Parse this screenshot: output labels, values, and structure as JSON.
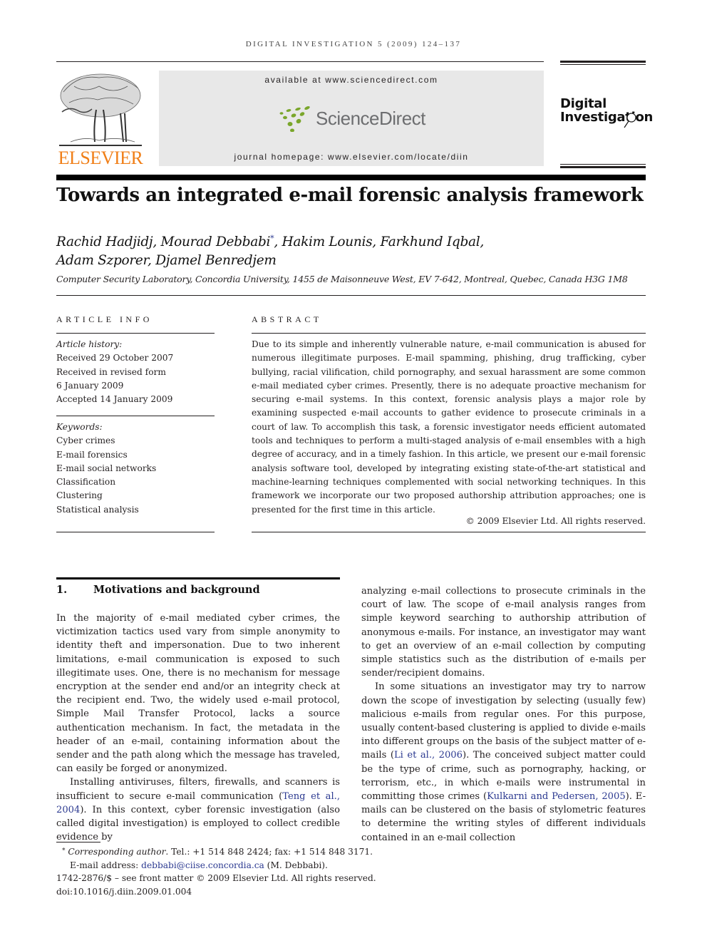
{
  "running_head": "DIGITAL INVESTIGATION 5 (2009) 124–137",
  "header": {
    "publisher_logo_text": "ELSEVIER",
    "available_at": "available at www.sciencedirect.com",
    "sciencedirect_logo_text": "ScienceDirect",
    "journal_homepage": "journal homepage: www.elsevier.com/locate/diin",
    "journal_logo_line1": "Digital",
    "journal_logo_line2": "Investigation",
    "colors": {
      "elsevier_orange": "#f07f18",
      "sciencedirect_green": "#7aa62b",
      "link_blue": "#2b3990"
    }
  },
  "article": {
    "title": "Towards an integrated e-mail forensic analysis framework",
    "authors_line1": "Rachid Hadjidj, Mourad Debbabi",
    "corresponding_mark": "*",
    "authors_line1_rest": ", Hakim Lounis, Farkhund Iqbal,",
    "authors_line2": "Adam Szporer, Djamel Benredjem",
    "affiliation": "Computer Security Laboratory, Concordia University, 1455 de Maisonneuve West, EV 7-642, Montreal, Quebec, Canada H3G 1M8"
  },
  "article_info": {
    "heading": "ARTICLE INFO",
    "history_label": "Article history:",
    "history": [
      "Received 29 October 2007",
      "Received in revised form",
      "6 January 2009",
      "Accepted 14 January 2009"
    ],
    "keywords_label": "Keywords:",
    "keywords": [
      "Cyber crimes",
      "E-mail forensics",
      "E-mail social networks",
      "Classification",
      "Clustering",
      "Statistical analysis"
    ]
  },
  "abstract": {
    "heading": "ABSTRACT",
    "text": "Due to its simple and inherently vulnerable nature, e-mail communication is abused for numerous illegitimate purposes. E-mail spamming, phishing, drug trafficking, cyber bullying, racial vilification, child pornography, and sexual harassment are some common e-mail mediated cyber crimes. Presently, there is no adequate proactive mechanism for securing e-mail systems. In this context, forensic analysis plays a major role by examining suspected e-mail accounts to gather evidence to prosecute criminals in a court of law. To accomplish this task, a forensic investigator needs efficient automated tools and techniques to perform a multi-staged analysis of e-mail ensembles with a high degree of accuracy, and in a timely fashion. In this article, we present our e-mail forensic analysis software tool, developed by integrating existing state-of-the-art statistical and machine-learning techniques complemented with social networking techniques. In this framework we incorporate our two proposed authorship attribution approaches; one is presented for the first time in this article.",
    "copyright": "© 2009 Elsevier Ltd. All rights reserved."
  },
  "section1": {
    "number": "1.",
    "title": "Motivations and background",
    "left_p1": "In the majority of e-mail mediated cyber crimes, the victimization tactics used vary from simple anonymity to identity theft and impersonation. Due to two inherent limitations, e-mail communication is exposed to such illegitimate uses. One, there is no mechanism for message encryption at the sender end and/or an integrity check at the recipient end. Two, the widely used e-mail protocol, Simple Mail Transfer Protocol, lacks a source authentication mechanism. In fact, the metadata in the header of an e-mail, containing information about the sender and the path along which the message has traveled, can easily be forged or anonymized.",
    "left_p2_a": "Installing antiviruses, filters, firewalls, and scanners is insufficient to secure e-mail communication (",
    "left_p2_cite": "Teng et al., 2004",
    "left_p2_b": "). In this context, cyber forensic investigation (also called digital investigation) is employed to collect credible evidence by",
    "right_p1": "analyzing e-mail collections to prosecute criminals in the court of law. The scope of e-mail analysis ranges from simple keyword searching to authorship attribution of anonymous e-mails. For instance, an investigator may want to get an overview of an e-mail collection by computing simple statistics such as the distribution of e-mails per sender/recipient domains.",
    "right_p2_a": "In some situations an investigator may try to narrow down the scope of investigation by selecting (usually few) malicious e-mails from regular ones. For this purpose, usually content-based clustering is applied to divide e-mails into different groups on the basis of the subject matter of e-mails (",
    "right_p2_cite1": "Li et al., 2006",
    "right_p2_b": "). The conceived subject matter could be the type of crime, such as pornography, hacking, or terrorism, etc., in which e-mails were instrumental in committing those crimes (",
    "right_p2_cite2": "Kulkarni and Pedersen, 2005",
    "right_p2_c": "). E-mails can be clustered on the basis of stylometric features to determine the writing styles of different individuals contained in an e-mail collection"
  },
  "footnotes": {
    "mark": "*",
    "corresponding_label": "Corresponding author",
    "contact": ". Tel.: +1 514 848 2424; fax: +1 514 848 3171.",
    "email_label": "E-mail address: ",
    "email": "debbabi@ciise.concordia.ca",
    "email_owner": " (M. Debbabi).",
    "issn_line": "1742-2876/$ – see front matter © 2009 Elsevier Ltd. All rights reserved.",
    "doi": "doi:10.1016/j.diin.2009.01.004"
  }
}
